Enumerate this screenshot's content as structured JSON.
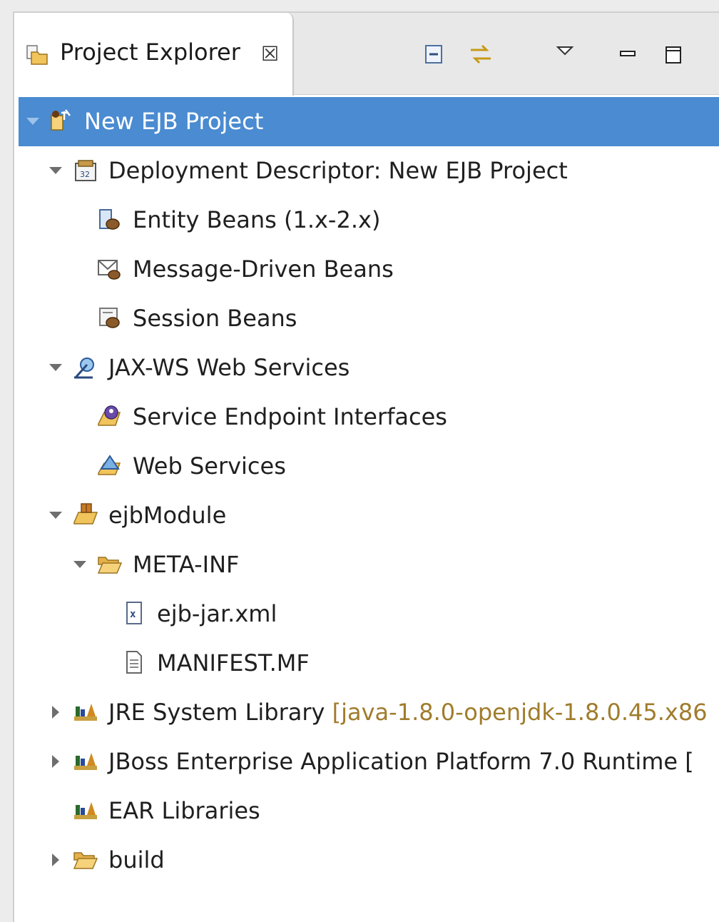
{
  "tab": {
    "title": "Project Explorer",
    "close_glyph": "☒"
  },
  "toolbar": {
    "buttons": [
      "collapse-all-icon",
      "link-with-editor-icon",
      "view-menu-icon",
      "minimize-icon",
      "maximize-icon"
    ]
  },
  "tree": {
    "rows": [
      {
        "label": "New EJB Project",
        "icon": "ejb-project-icon",
        "expanded": true,
        "selected": true
      },
      {
        "label": "Deployment Descriptor: New EJB Project",
        "icon": "deployment-descriptor-icon",
        "expanded": true
      },
      {
        "label": "Entity Beans (1.x-2.x)",
        "icon": "entity-beans-icon"
      },
      {
        "label": "Message-Driven Beans",
        "icon": "message-driven-beans-icon"
      },
      {
        "label": "Session Beans",
        "icon": "session-beans-icon"
      },
      {
        "label": "JAX-WS Web Services",
        "icon": "jax-ws-icon",
        "expanded": true
      },
      {
        "label": "Service Endpoint Interfaces",
        "icon": "service-endpoint-icon"
      },
      {
        "label": "Web Services",
        "icon": "web-services-icon"
      },
      {
        "label": "ejbModule",
        "icon": "source-folder-icon",
        "expanded": true
      },
      {
        "label": "META-INF",
        "icon": "folder-open-icon",
        "expanded": true
      },
      {
        "label": "ejb-jar.xml",
        "icon": "xml-file-icon"
      },
      {
        "label": "MANIFEST.MF",
        "icon": "text-file-icon"
      },
      {
        "label": "JRE System Library",
        "decoration": "[java-1.8.0-openjdk-1.8.0.45.x86",
        "icon": "library-icon",
        "expanded": false
      },
      {
        "label": "JBoss Enterprise Application Platform 7.0 Runtime [",
        "icon": "library-icon",
        "expanded": false
      },
      {
        "label": "EAR Libraries",
        "icon": "library-icon"
      },
      {
        "label": "build",
        "icon": "folder-icon",
        "expanded": false
      }
    ]
  },
  "colors": {
    "selection": "#4a8bd1",
    "decoration": "#a07c2c"
  }
}
